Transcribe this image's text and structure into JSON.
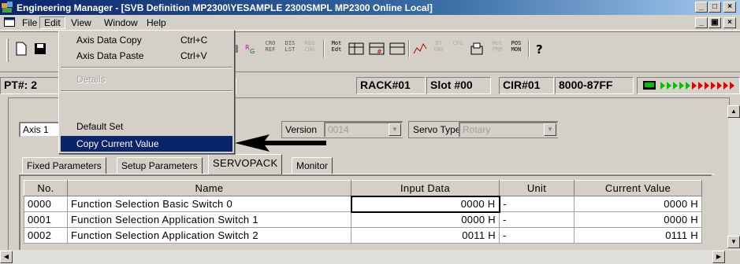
{
  "window": {
    "title": "Engineering Manager - [SVB Definition   MP2300\\YESAMPLE 2300SMPL MP2300   Online Local]",
    "minimize": "_",
    "restore": "□",
    "close": "×"
  },
  "menubar": {
    "items": [
      "File",
      "Edit",
      "View",
      "Window",
      "Help"
    ]
  },
  "toolbar": {
    "buttons": [
      "CRO REF",
      "DIS LST",
      "REG CHG",
      "Mot Edt",
      "DT ENV",
      "CFG",
      "Mot PRM",
      "POS MON"
    ]
  },
  "status": {
    "pt": "PT#: 2",
    "rack": "RACK#01",
    "slot": "Slot #00",
    "cir": "CIR#01",
    "range": "8000-87FF"
  },
  "form": {
    "axis_value": "Axis 1",
    "version_label": "Version",
    "version_value": "0014",
    "servo_type_label": "Servo Type",
    "servo_type_value": "Rotary"
  },
  "tabs": [
    "Fixed Parameters",
    "Setup Parameters",
    "SERVOPACK",
    "Monitor"
  ],
  "table": {
    "headers": [
      "No.",
      "Name",
      "Input Data",
      "Unit",
      "Current Value"
    ],
    "rows": [
      [
        "0000",
        "Function Selection Basic Switch 0",
        "0000 H",
        "-",
        "0000 H"
      ],
      [
        "0001",
        "Function Selection Application Switch 1",
        "0000 H",
        "-",
        "0000 H"
      ],
      [
        "0002",
        "Function Selection Application Switch 2",
        "0011 H",
        "-",
        "0111 H"
      ]
    ]
  },
  "edit_menu": {
    "axis_data_copy": "Axis Data Copy",
    "axis_data_copy_shortcut": "Ctrl+C",
    "axis_data_paste": "Axis Data Paste",
    "axis_data_paste_shortcut": "Ctrl+V",
    "details": "Details",
    "default_set": "Default Set",
    "copy_current_value": "Copy Current Value"
  },
  "colors": {
    "highlight": "#0a246a",
    "title_gradient_end": "#a6caf0",
    "arrow": "#000000",
    "indicator_green": "#00c000",
    "indicator_red": "#e00000"
  }
}
